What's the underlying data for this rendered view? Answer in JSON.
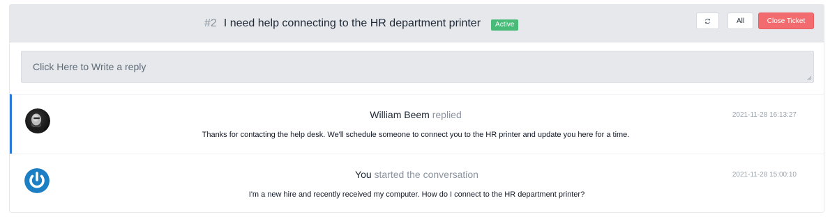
{
  "ticket": {
    "number": "#2",
    "title": "I need help connecting to the HR department printer",
    "status": "Active",
    "status_color": "#48bb78"
  },
  "toolbar": {
    "refresh_icon": "refresh-icon",
    "all_label": "All",
    "close_label": "Close Ticket",
    "close_color": "#f16b6f"
  },
  "reply": {
    "placeholder": "Click Here to Write a reply"
  },
  "messages": [
    {
      "author": "William Beem",
      "verb": "replied",
      "timestamp": "2021-11-28 16:13:27",
      "body": "Thanks for contacting the help desk. We'll schedule someone to connect you to the HR printer and update you here for a time.",
      "avatar": "user-photo",
      "accent_color": "#2b7bd6"
    },
    {
      "author": "You",
      "verb": "started the conversation",
      "timestamp": "2021-11-28 15:00:10",
      "body": "I'm a new hire and recently received my computer. How do I connect to the HR department printer?",
      "avatar": "power-logo-icon"
    }
  ]
}
